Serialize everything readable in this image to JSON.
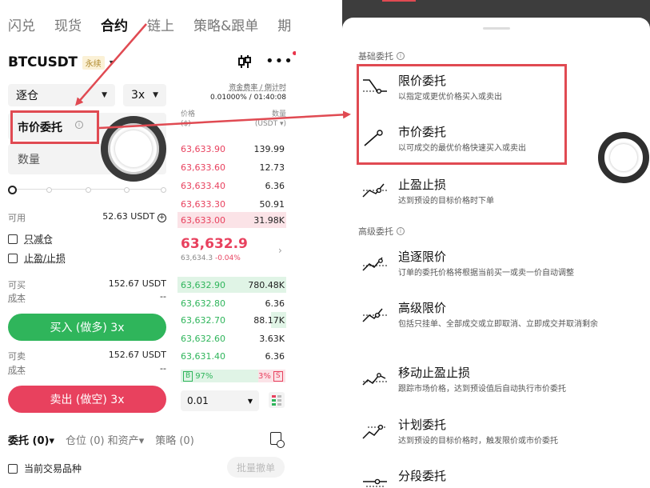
{
  "left": {
    "top_tabs": [
      "闪兑",
      "现货",
      "合约",
      "链上",
      "策略&跟单",
      "期"
    ],
    "pair": {
      "symbol": "BTCUSDT",
      "badge": "永续"
    },
    "margin_mode": "逐仓",
    "leverage": "3x",
    "funding": {
      "label": "资金费率 / 倒计时",
      "value": "0.01000% / 01:40:08"
    },
    "order_type": "市价委托",
    "quantity_placeholder": "数量",
    "available": {
      "label": "可用",
      "value": "52.63 USDT"
    },
    "reduce_only": "只减仓",
    "tp_sl": "止盈/止损",
    "can_buy": {
      "label": "可买",
      "value": "152.67 USDT"
    },
    "cost_buy": {
      "label": "成本",
      "value": "--"
    },
    "buy_button": "买入 (做多) 3x",
    "can_sell": {
      "label": "可卖",
      "value": "152.67 USDT"
    },
    "cost_sell": {
      "label": "成本",
      "value": "--"
    },
    "sell_button": "卖出 (做空) 3x",
    "orderbook": {
      "price_label": "价格",
      "price_unit": "($)",
      "qty_label": "数量",
      "qty_unit": "(USDT ▾)",
      "asks": [
        {
          "price": "63,633.90",
          "qty": "139.99"
        },
        {
          "price": "63,633.60",
          "qty": "12.73"
        },
        {
          "price": "63,633.40",
          "qty": "6.36"
        },
        {
          "price": "63,633.30",
          "qty": "50.91"
        },
        {
          "price": "63,633.00",
          "qty": "31.98K"
        }
      ],
      "last_price": "63,632.9",
      "mark_price": "63,634.3",
      "change": "-0.04%",
      "bids": [
        {
          "price": "63,632.90",
          "qty": "780.48K"
        },
        {
          "price": "63,632.80",
          "qty": "6.36"
        },
        {
          "price": "63,632.70",
          "qty": "88.17K"
        },
        {
          "price": "63,632.60",
          "qty": "3.63K"
        },
        {
          "price": "63,631.40",
          "qty": "6.36"
        }
      ],
      "buy_ratio": "97%",
      "sell_ratio": "3%",
      "buy_tag": "B",
      "sell_tag": "S",
      "step": "0.01"
    },
    "bottom_tabs": [
      "委托 (0)",
      "仓位 (0) 和资产",
      "策略 (0)"
    ],
    "current_pair_only": "当前交易品种",
    "batch_cancel": "批量撤单"
  },
  "right": {
    "basic_section": "基础委托",
    "advanced_section": "高级委托",
    "basic_options": [
      {
        "title": "限价委托",
        "desc": "以指定或更优价格买入或卖出"
      },
      {
        "title": "市价委托",
        "desc": "以可成交的最优价格快速买入或卖出"
      },
      {
        "title": "止盈止损",
        "desc": "达到预设的目标价格时下单"
      }
    ],
    "advanced_options": [
      {
        "title": "追逐限价",
        "desc": "订单的委托价格将根据当前买一或卖一价自动调整"
      },
      {
        "title": "高级限价",
        "desc": "包括只挂单、全部成交或立即取消、立即成交并取消剩余"
      },
      {
        "title": "移动止盈止损",
        "desc": "跟踪市场价格，达到预设值后自动执行市价委托"
      },
      {
        "title": "计划委托",
        "desc": "达到预设的目标价格时，触发限价或市价委托"
      },
      {
        "title": "分段委托",
        "desc": ""
      }
    ]
  },
  "colors": {
    "buy": "#2fb55b",
    "sell": "#e8415e",
    "highlight": "#e04a52"
  }
}
